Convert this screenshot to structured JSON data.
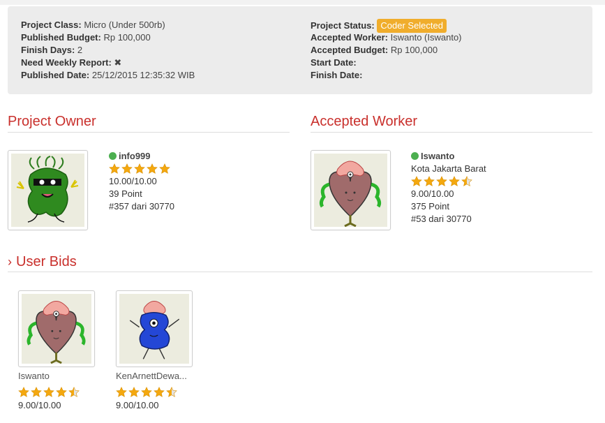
{
  "project_info": {
    "class_label": "Project Class:",
    "class_value": "Micro (Under 500rb)",
    "budget_label": "Published Budget:",
    "budget_value": "Rp 100,000",
    "finish_days_label": "Finish Days:",
    "finish_days_value": "2",
    "weekly_report_label": "Need Weekly Report:",
    "weekly_report_value": "✖",
    "published_date_label": "Published Date:",
    "published_date_value": "25/12/2015 12:35:32 WIB",
    "status_label": "Project Status:",
    "status_value": "Coder Selected",
    "accepted_worker_label": "Accepted Worker:",
    "accepted_worker_value": "Iswanto (Iswanto)",
    "accepted_budget_label": "Accepted Budget:",
    "accepted_budget_value": "Rp 100,000",
    "start_date_label": "Start Date:",
    "finish_date_label": "Finish Date:"
  },
  "owner": {
    "section_title": "Project Owner",
    "username": "info999",
    "rating_stars": 5,
    "rating": "10.00/10.00",
    "points": "39 Point",
    "rank": "#357 dari 30770"
  },
  "worker": {
    "section_title": "Accepted Worker",
    "username": "Iswanto",
    "location": "Kota Jakarta Barat",
    "rating_stars": 4.5,
    "rating": "9.00/10.00",
    "points": "375 Point",
    "rank": "#53 dari 30770"
  },
  "bids": {
    "section_title": "User Bids",
    "items": [
      {
        "name": "Iswanto",
        "rating_stars": 4.5,
        "rating": "9.00/10.00"
      },
      {
        "name": "KenArnettDewa...",
        "rating_stars": 4.5,
        "rating": "9.00/10.00"
      }
    ]
  },
  "colors": {
    "accent_red": "#c9302c",
    "badge_orange": "#f0ad2c",
    "star_gold": "#f4a80f",
    "online_green": "#4caf50"
  }
}
